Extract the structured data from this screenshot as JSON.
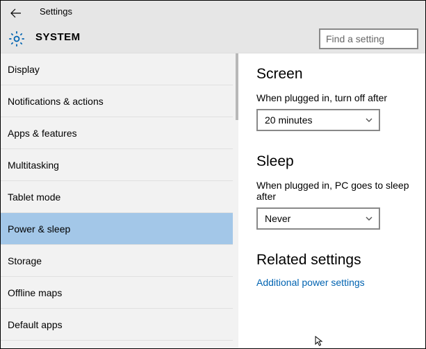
{
  "header": {
    "title": "Settings",
    "section": "SYSTEM",
    "search_placeholder": "Find a setting"
  },
  "sidebar": {
    "items": [
      {
        "label": "Display"
      },
      {
        "label": "Notifications & actions"
      },
      {
        "label": "Apps & features"
      },
      {
        "label": "Multitasking"
      },
      {
        "label": "Tablet mode"
      },
      {
        "label": "Power & sleep"
      },
      {
        "label": "Storage"
      },
      {
        "label": "Offline maps"
      },
      {
        "label": "Default apps"
      }
    ],
    "selected_index": 5
  },
  "content": {
    "screen": {
      "title": "Screen",
      "plugged_label": "When plugged in, turn off after",
      "plugged_value": "20 minutes"
    },
    "sleep": {
      "title": "Sleep",
      "plugged_label": "When plugged in, PC goes to sleep after",
      "plugged_value": "Never"
    },
    "related": {
      "title": "Related settings",
      "link": "Additional power settings"
    }
  }
}
